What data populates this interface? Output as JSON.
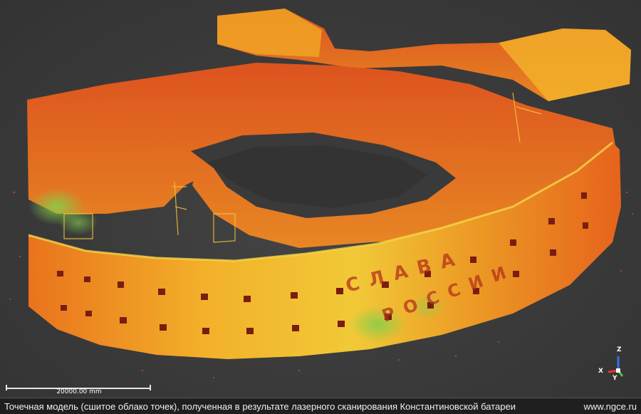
{
  "viewport": {
    "scene": "point-cloud-3d-view",
    "colors": {
      "background": "#3a3a3a",
      "hot": "#e8461e",
      "warm": "#f59a1c",
      "yellow": "#f3d33a",
      "green": "#7cc444"
    },
    "lettering_top_row": "СЛАВА",
    "lettering_bottom_row": "РОССИИ",
    "scale_bar_label": "20000.00 mm",
    "axes": {
      "z": "Z",
      "x": "X",
      "y": "Y"
    }
  },
  "caption_bar": {
    "caption": "Точечная модель (сшитое облако точек), полученная в результате лазерного сканирования Константиновской батареи",
    "site_link": "www.ngce.ru"
  }
}
